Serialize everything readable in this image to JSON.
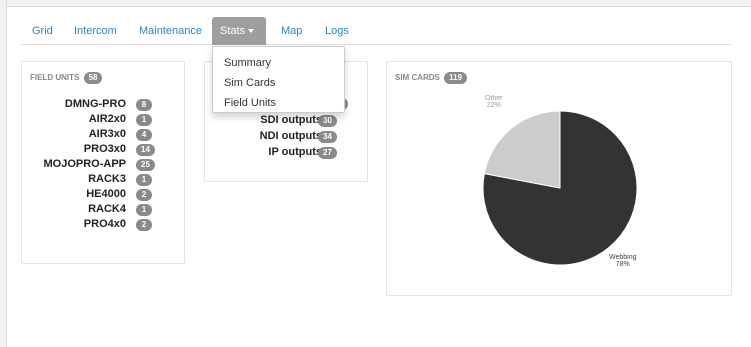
{
  "nav": {
    "tabs": [
      {
        "label": "Grid"
      },
      {
        "label": "Intercom"
      },
      {
        "label": "Maintenance"
      },
      {
        "label": "Stats"
      },
      {
        "label": "Map"
      },
      {
        "label": "Logs"
      }
    ],
    "active_tab": "Stats"
  },
  "stats_menu": {
    "items": [
      {
        "label": "Summary"
      },
      {
        "label": "Sim Cards"
      },
      {
        "label": "Field Units"
      }
    ]
  },
  "field_units": {
    "title": "FIELD UNITS",
    "total": "58",
    "rows": [
      {
        "name": "DMNG-PRO",
        "count": "8"
      },
      {
        "name": "AIR2x0",
        "count": "1"
      },
      {
        "name": "AIR3x0",
        "count": "4"
      },
      {
        "name": "PRO3x0",
        "count": "14"
      },
      {
        "name": "MOJOPRO-APP",
        "count": "25"
      },
      {
        "name": "RACK3",
        "count": "1"
      },
      {
        "name": "HE4000",
        "count": "2"
      },
      {
        "name": "RACK4",
        "count": "1"
      },
      {
        "name": "PRO4x0",
        "count": "2"
      }
    ]
  },
  "outputs": {
    "rows": [
      {
        "name": "SDI outputs",
        "count": "30"
      },
      {
        "name": "NDI outputs",
        "count": "34"
      },
      {
        "name": "IP outputs",
        "count": "27"
      }
    ]
  },
  "sim_cards": {
    "title": "SIM CARDS",
    "total": "119"
  },
  "chart_data": {
    "type": "pie",
    "slices": [
      {
        "label": "Webbing",
        "percent_label": "78%",
        "value": 78,
        "color": "#333333"
      },
      {
        "label": "Other",
        "percent_label": "22%",
        "value": 22,
        "color": "#cccccc"
      }
    ]
  }
}
